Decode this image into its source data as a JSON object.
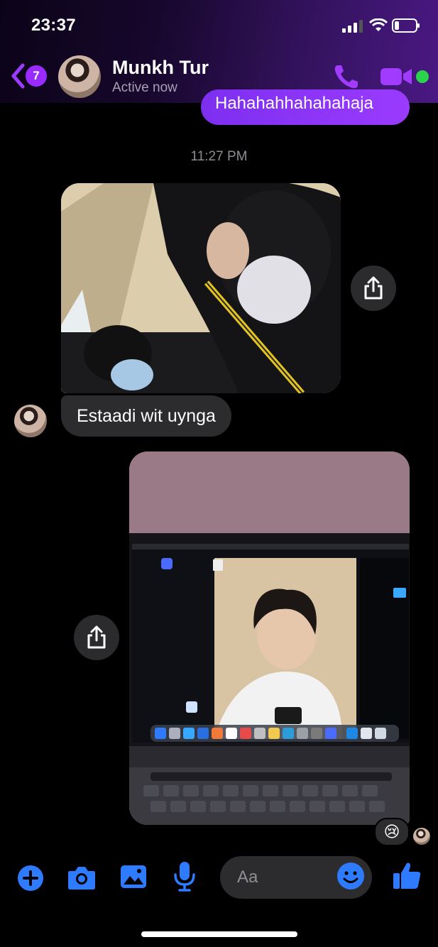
{
  "status_bar": {
    "time": "23:37"
  },
  "header": {
    "unread_count": "7",
    "contact_name": "Munkh Tur",
    "contact_status": "Active now"
  },
  "messages": {
    "partial_bubble_text": "Hahahahhahahahaja",
    "time_separator": "11:27 PM",
    "received_text": "Estaadi wit uynga",
    "reaction_emoji": "😢"
  },
  "composer": {
    "placeholder": "Aa"
  },
  "colors": {
    "accent": "#8a2be2",
    "online": "#2bd34c",
    "composer_blue": "#2f7bff"
  }
}
